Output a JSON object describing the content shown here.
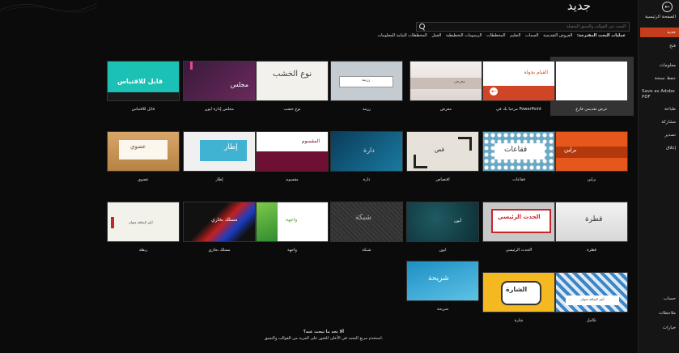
{
  "window": {
    "title": "جديد"
  },
  "sidebar": {
    "items": [
      {
        "label": "الصفحة الرئيسية",
        "icon": "home-icon"
      },
      {
        "label": "جديد",
        "icon": "new-file-icon",
        "active": true
      },
      {
        "label": "فتح",
        "icon": "folder-open-icon"
      },
      {
        "label": "معلومات"
      },
      {
        "label": "حفظ نسخة"
      },
      {
        "label": "Save as Adobe PDF"
      },
      {
        "label": "طباعة"
      },
      {
        "label": "مشاركة"
      },
      {
        "label": "تصدير"
      },
      {
        "label": "إغلاق"
      }
    ],
    "bottom_items": [
      {
        "label": "حساب"
      },
      {
        "label": "ملاحظات"
      },
      {
        "label": "خيارات"
      }
    ]
  },
  "search": {
    "placeholder": "البحث عن القوالب والنسق المتصلة"
  },
  "suggested": {
    "heading": "عمليات البحث المقترحة:",
    "items": [
      "العروض التقديمية",
      "السمات",
      "التعليم",
      "المخططات",
      "الرسومات التخطيطية",
      "العمل",
      "المخططات البيانية للمعلومات"
    ]
  },
  "templates": [
    {
      "caption": "عرض تقديمي فارغ"
    },
    {
      "caption": "مرحباً بك في PowerPoint",
      "text": "القيام بجولة"
    },
    {
      "caption": "معرض",
      "text": "معرض"
    },
    {
      "caption": "رزمة",
      "text": "رزمة"
    },
    {
      "caption": "نوع خشب",
      "text": "نوع الخشب"
    },
    {
      "caption": "مجلس إدارة أيون",
      "text": "مجلس"
    },
    {
      "caption": "قابل للاقتباس",
      "text": "قابل للاقتباس"
    },
    {
      "caption": "برلين",
      "text": "برلين"
    },
    {
      "caption": "فقاعات",
      "text": "فقاعات"
    },
    {
      "caption": "اقتصاص",
      "text": "قص"
    },
    {
      "caption": "دارة",
      "text": "دارة"
    },
    {
      "caption": "مقسوم",
      "text": "المقسوم"
    },
    {
      "caption": "إطار",
      "text": "إطار"
    },
    {
      "caption": "عضوي",
      "text": "عضوي"
    },
    {
      "caption": "قطرة",
      "text": "قطرة"
    },
    {
      "caption": "الحدث الرئيسي",
      "text": "الحدث الرئيسي"
    },
    {
      "caption": "أيون",
      "text": "أيون"
    },
    {
      "caption": "شبكة",
      "text": "شبكة"
    },
    {
      "caption": "واجهة",
      "text": "واجهة"
    },
    {
      "caption": "مسلك بخاري",
      "text": "مسلك بخاري"
    },
    {
      "caption": "ربطة",
      "text": "أنقر لإضافة عنوان"
    },
    {
      "caption": "تكامل",
      "text": "أنقر لإضافة عنوان"
    },
    {
      "caption": "شارة",
      "text": "الشارة"
    },
    {
      "caption": "شريحة",
      "text": "شريحة"
    }
  ],
  "footer": {
    "question": "ألا تجد ما تبحث عنه؟",
    "hint": "استخدم مربع البحث في الأعلى للعثور على المزيد من القوالب والنسق."
  },
  "colors": {
    "accent": "#c43e1c",
    "background": "#0b0b0b",
    "sidebar": "#151515"
  }
}
